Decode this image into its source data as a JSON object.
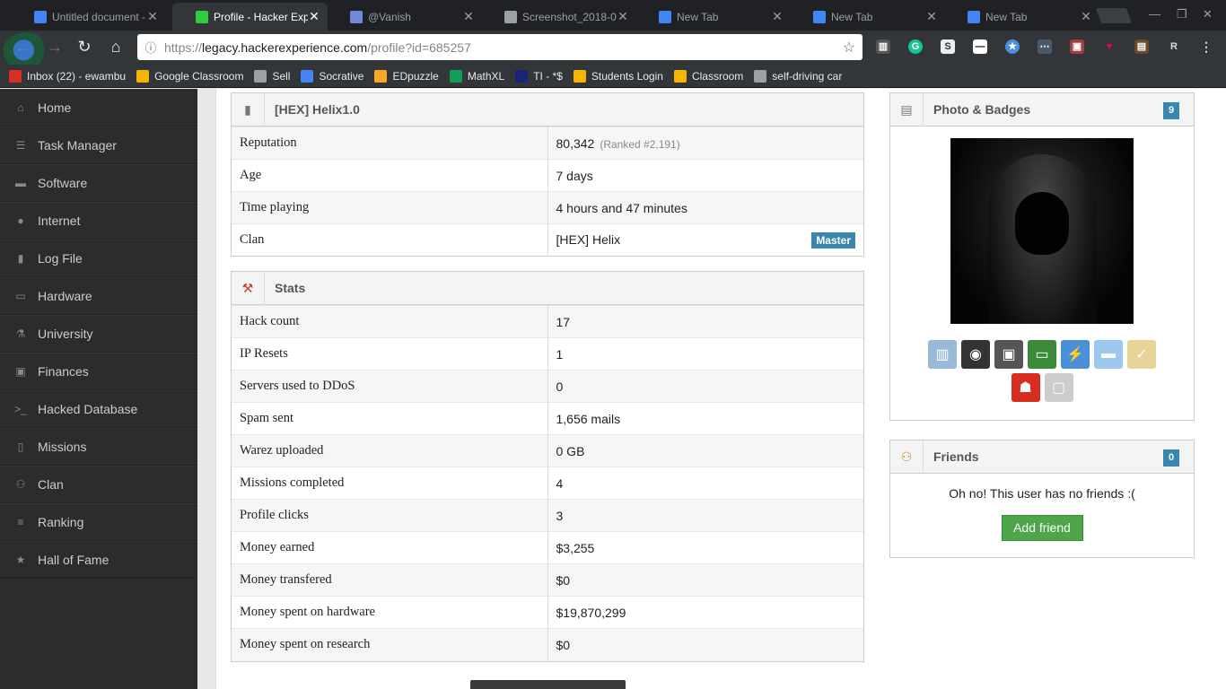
{
  "browser": {
    "tabs": [
      {
        "title": "Untitled document -",
        "favicon_color": "#4285f4",
        "active": false
      },
      {
        "title": "Profile - Hacker Expe",
        "favicon_color": "#2ecc40",
        "active": true
      },
      {
        "title": "@Vanish",
        "favicon_color": "#7289da",
        "active": false
      },
      {
        "title": "Screenshot_2018-0",
        "favicon_color": "#9aa0a6",
        "active": false
      },
      {
        "title": "New Tab",
        "favicon_color": "#4285f4",
        "active": false
      },
      {
        "title": "New Tab",
        "favicon_color": "#4285f4",
        "active": false
      },
      {
        "title": "New Tab",
        "favicon_color": "#4285f4",
        "active": false
      }
    ],
    "url_scheme": "https://",
    "url_host": "legacy.hackerexperience.com",
    "url_path": "/profile?id=685257",
    "bookmarks": [
      {
        "label": "Inbox (22) - ewambu",
        "icon": "gmail-icon",
        "color": "#d93025"
      },
      {
        "label": "Google Classroom",
        "icon": "classroom-icon",
        "color": "#f4b400"
      },
      {
        "label": "Sell",
        "icon": "page-icon",
        "color": "#9aa0a6"
      },
      {
        "label": "Socrative",
        "icon": "socrative-icon",
        "color": "#4285f4"
      },
      {
        "label": "EDpuzzle",
        "icon": "edpuzzle-icon",
        "color": "#f9a825"
      },
      {
        "label": "MathXL",
        "icon": "mathxl-icon",
        "color": "#0f9d58"
      },
      {
        "label": "TI - *$",
        "icon": "tn-icon",
        "color": "#1a237e"
      },
      {
        "label": "Students Login",
        "icon": "clever-icon",
        "color": "#f4b400"
      },
      {
        "label": "Classroom",
        "icon": "classroom-icon",
        "color": "#f4b400"
      },
      {
        "label": "self-driving car",
        "icon": "folder-icon",
        "color": "#9aa0a6"
      }
    ]
  },
  "sidebar": {
    "items": [
      {
        "label": "Home",
        "icon": "home-icon",
        "glyph": "⌂"
      },
      {
        "label": "Task Manager",
        "icon": "task-manager-icon",
        "glyph": "☰"
      },
      {
        "label": "Software",
        "icon": "folder-icon",
        "glyph": "▬"
      },
      {
        "label": "Internet",
        "icon": "globe-icon",
        "glyph": "●"
      },
      {
        "label": "Log File",
        "icon": "book-icon",
        "glyph": "▮"
      },
      {
        "label": "Hardware",
        "icon": "monitor-icon",
        "glyph": "▭"
      },
      {
        "label": "University",
        "icon": "flask-icon",
        "glyph": "⚗"
      },
      {
        "label": "Finances",
        "icon": "briefcase-icon",
        "glyph": "▣"
      },
      {
        "label": "Hacked Database",
        "icon": "terminal-icon",
        "glyph": ">_"
      },
      {
        "label": "Missions",
        "icon": "building-icon",
        "glyph": "▯"
      },
      {
        "label": "Clan",
        "icon": "users-icon",
        "glyph": "⚇"
      },
      {
        "label": "Ranking",
        "icon": "list-icon",
        "glyph": "≡"
      },
      {
        "label": "Hall of Fame",
        "icon": "star-icon",
        "glyph": "★"
      }
    ]
  },
  "profile": {
    "header": "[HEX] Helix1.0",
    "rows": [
      {
        "key": "Reputation",
        "value": "80,342",
        "extra": "(Ranked #2,191)"
      },
      {
        "key": "Age",
        "value": "7 days"
      },
      {
        "key": "Time playing",
        "value": "4 hours and 47 minutes"
      },
      {
        "key": "Clan",
        "value": "[HEX] Helix",
        "badge": "Master"
      }
    ]
  },
  "stats": {
    "header": "Stats",
    "rows": [
      {
        "key": "Hack count",
        "value": "17",
        "money": false
      },
      {
        "key": "IP Resets",
        "value": "1",
        "money": false
      },
      {
        "key": "Servers used to DDoS",
        "value": "0",
        "money": false
      },
      {
        "key": "Spam sent",
        "value": "1,656 mails",
        "money": false
      },
      {
        "key": "Warez uploaded",
        "value": "0 GB",
        "money": false
      },
      {
        "key": "Missions completed",
        "value": "4",
        "money": false
      },
      {
        "key": "Profile clicks",
        "value": "3",
        "money": false
      },
      {
        "key": "Money earned",
        "value": "$3,255",
        "money": true
      },
      {
        "key": "Money transfered",
        "value": "$0",
        "money": true
      },
      {
        "key": "Money spent on hardware",
        "value": "$19,870,299",
        "money": true
      },
      {
        "key": "Money spent on research",
        "value": "$0",
        "money": true
      }
    ]
  },
  "photo": {
    "header": "Photo & Badges",
    "count": "9",
    "badges": [
      {
        "icon": "server-rack-badge-icon",
        "color": "#9ab8d8"
      },
      {
        "icon": "hard-disk-badge-icon",
        "color": "#333"
      },
      {
        "icon": "processor-badge-icon",
        "color": "#555"
      },
      {
        "icon": "ram-badge-icon",
        "color": "#3a8a3a"
      },
      {
        "icon": "network-cable-badge-icon",
        "color": "#4a90d9"
      },
      {
        "icon": "progress-badge-icon",
        "color": "#9cc8f0"
      },
      {
        "icon": "certificate-badge-icon",
        "color": "#e8d49a"
      },
      {
        "icon": "hero-badge-icon",
        "color": "#d62d20"
      },
      {
        "icon": "external-hd-badge-icon",
        "color": "#ccc"
      }
    ]
  },
  "friends": {
    "header": "Friends",
    "count": "0",
    "empty_text": "Oh no! This user has no friends :(",
    "add_label": "Add friend"
  }
}
